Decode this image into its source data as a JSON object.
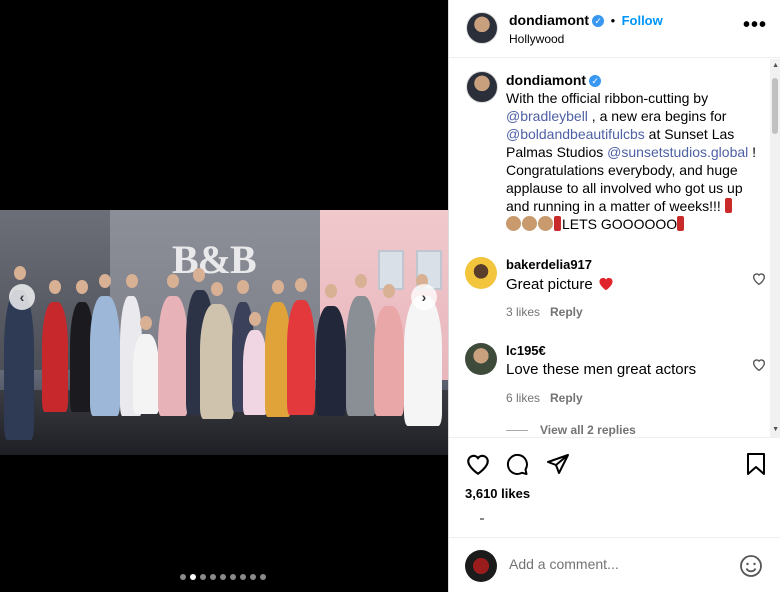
{
  "post": {
    "username": "dondiamont",
    "follow_label": "Follow",
    "location": "Hollywood",
    "more_label": "•••",
    "separator": "•"
  },
  "media": {
    "logo_text": "B&B",
    "prev_glyph": "‹",
    "next_glyph": "›",
    "dot_count": 9,
    "active_dot": 1
  },
  "caption": {
    "username": "dondiamont",
    "t1": "With the official ribbon-cutting by ",
    "m1": "@bradleybell",
    "t2": " , a new era begins for ",
    "m2": "@boldandbeautifulcbs",
    "t3": " at Sunset Las Palmas Studios ",
    "m3": "@sunsetstudios.global",
    "t4": " ! Congratulations everybody, and huge applause to all involved who got us up and running in a matter of weeks!!! ",
    "t5": "LETS GOOOOOO"
  },
  "comments": [
    {
      "user": "bakerdelia917",
      "text": "Great picture",
      "likes": "3 likes",
      "reply": "Reply"
    },
    {
      "user": "lc195€",
      "text": "Love these men great actors",
      "likes": "6 likes",
      "reply": "Reply"
    }
  ],
  "view_replies": "View all 2 replies",
  "likes_count": "3,610 likes",
  "add_comment_placeholder": "Add a comment...",
  "icons": [
    "heart-icon",
    "comment-icon",
    "share-icon",
    "bookmark-icon",
    "verified-icon",
    "emoji-icon"
  ],
  "colors": {
    "link": "#0095f6",
    "mention": "#4e60a5",
    "verified": "#3897f0",
    "red_heart": "#e0245e"
  }
}
